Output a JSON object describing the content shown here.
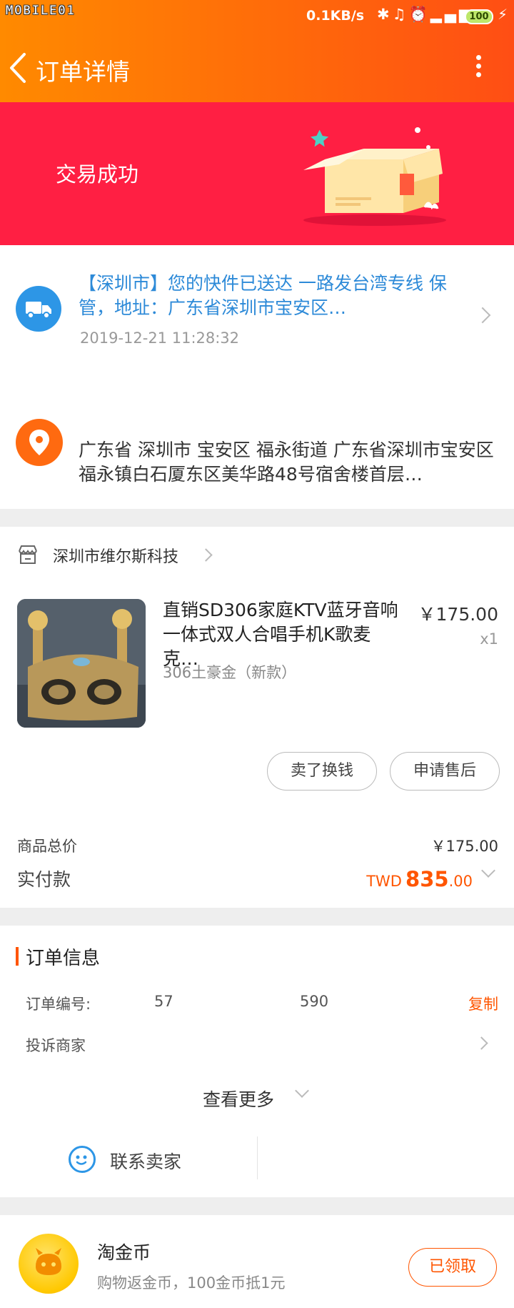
{
  "status_bar": {
    "watermark": "MOBILE01",
    "net_speed": "0.1KB/s",
    "icons": [
      "bluetooth-icon",
      "mute-icon",
      "alarm-icon",
      "signal-4g-icon"
    ],
    "battery": "100"
  },
  "header": {
    "title": "订单详情"
  },
  "banner": {
    "status": "交易成功"
  },
  "logistics": {
    "text": "【深圳市】您的快件已送达 一路发台湾专线 保管，地址：广东省深圳市宝安区…",
    "time": "2019-12-21 11:28:32"
  },
  "address": {
    "text": "广东省 深圳市 宝安区 福永街道 广东省深圳市宝安区福永镇白石厦东区美华路48号宿舍楼首层…"
  },
  "shop": {
    "name": "深圳市维尔斯科技"
  },
  "product": {
    "title": "直销SD306家庭KTV蓝牙音响一体式双人合唱手机K歌麦克…",
    "sku": "306土豪金（新款）",
    "price": "￥175.00",
    "qty": "x1"
  },
  "actions": {
    "sell_label": "卖了换钱",
    "after_sale_label": "申请售后"
  },
  "totals": {
    "goods_label": "商品总价",
    "goods_value": "￥175.00",
    "paid_label": "实付款",
    "paid_currency": "TWD",
    "paid_integer": "835",
    "paid_decimal": ".00"
  },
  "order_info": {
    "title": "订单信息",
    "number_label": "订单编号:",
    "number_part1": "57",
    "number_part2": "590",
    "copy_label": "复制",
    "complaint_label": "投诉商家",
    "see_more_label": "查看更多",
    "contact_label": "联系卖家"
  },
  "coins": {
    "title": "淘金币",
    "subtitle": "购物返金币，100金币抵1元",
    "button_label": "已领取"
  },
  "colors": {
    "accent": "#ff5500",
    "header_gradient_start": "#ff8a00",
    "banner": "#ff1f43",
    "link_blue": "#2d8ad8"
  }
}
